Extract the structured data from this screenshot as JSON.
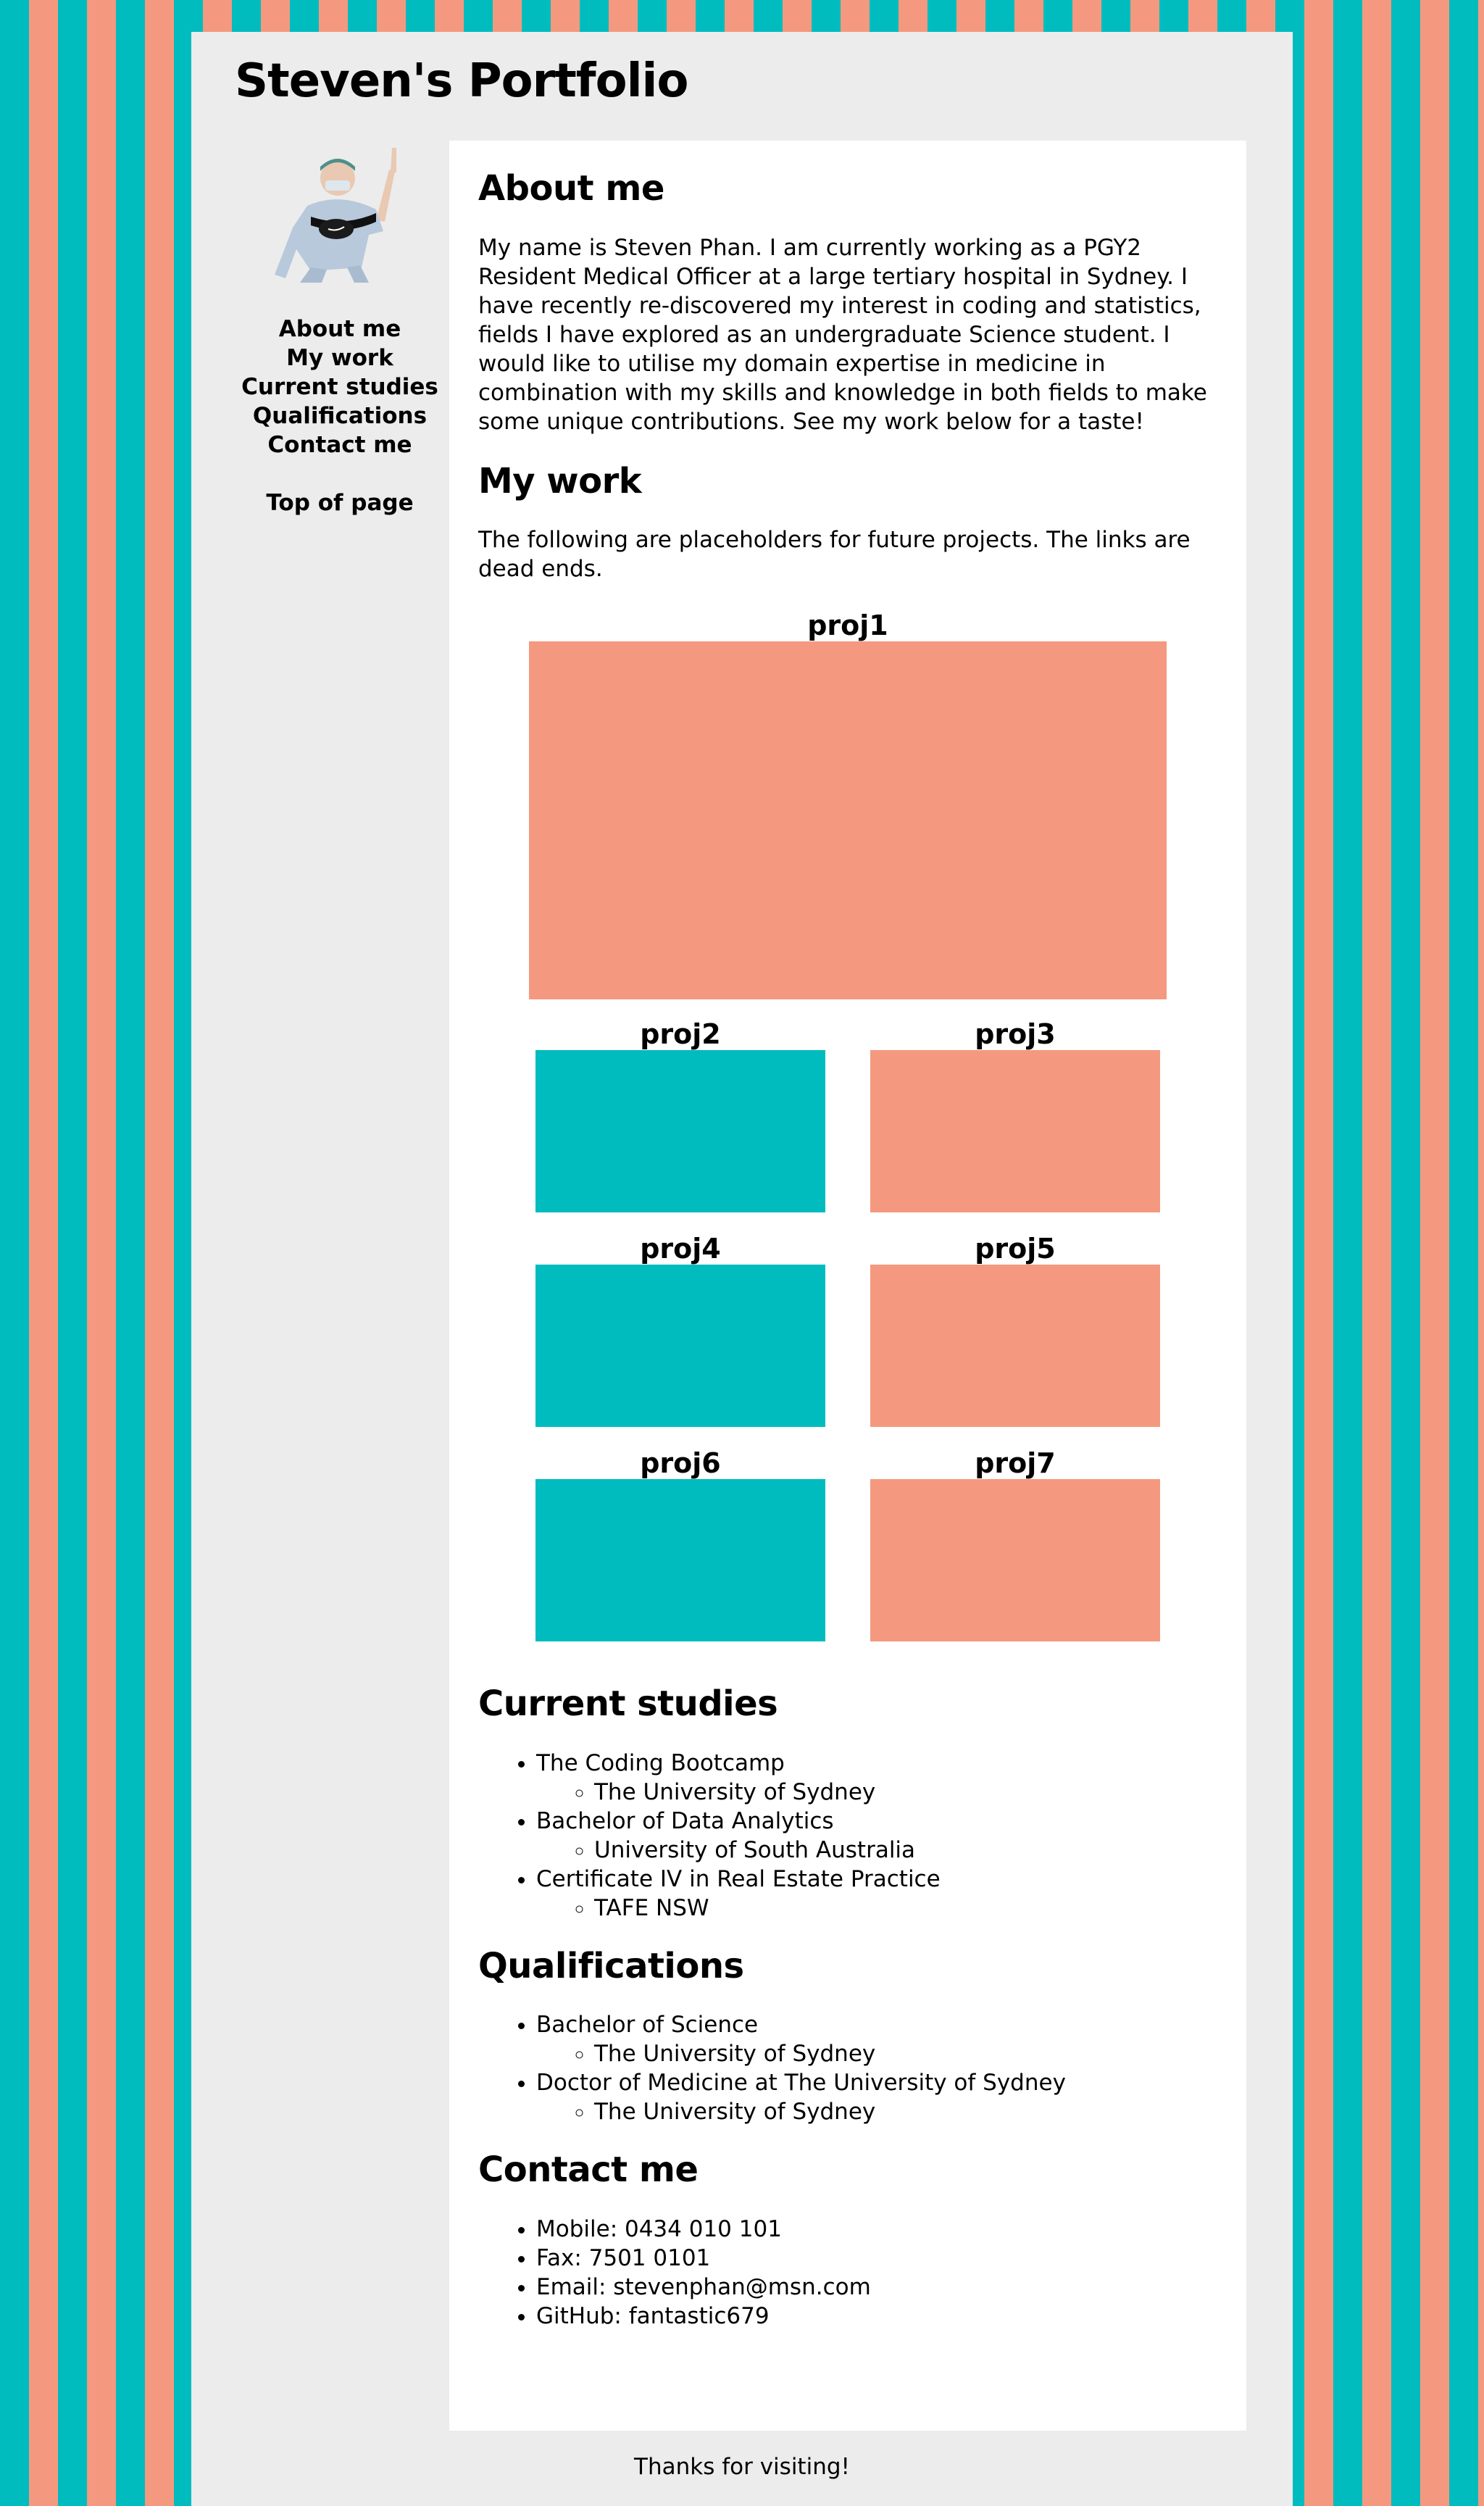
{
  "site_title": "Steven's Portfolio",
  "nav": {
    "items": [
      "About me",
      "My work",
      "Current studies",
      "Qualifications",
      "Contact me"
    ],
    "top_link": "Top of page"
  },
  "about": {
    "heading": "About me",
    "text": "My name is Steven Phan. I am currently working as a PGY2 Resident Medical Officer at a large tertiary hospital in Sydney. I have recently re-discovered my interest in coding and statistics, fields I have explored as an undergraduate Science student. I would like to utilise my domain expertise in medicine in combination with my skills and knowledge in both fields to make some unique contributions. See my work below for a taste!"
  },
  "work": {
    "heading": "My work",
    "intro": "The following are placeholders for future projects. The links are dead ends.",
    "projects": [
      "proj1",
      "proj2",
      "proj3",
      "proj4",
      "proj5",
      "proj6",
      "proj7"
    ]
  },
  "studies": {
    "heading": "Current studies",
    "items": [
      {
        "course": "The Coding Bootcamp",
        "institution": "The University of Sydney"
      },
      {
        "course": "Bachelor of Data Analytics",
        "institution": "University of South Australia"
      },
      {
        "course": "Certificate IV in Real Estate Practice",
        "institution": "TAFE NSW"
      }
    ]
  },
  "qualifications": {
    "heading": "Qualifications",
    "items": [
      {
        "degree": "Bachelor of Science",
        "institution": "The University of Sydney"
      },
      {
        "degree": "Doctor of Medicine at The University of Sydney",
        "institution": "The University of Sydney"
      }
    ]
  },
  "contact": {
    "heading": "Contact me",
    "items": [
      "Mobile: 0434 010 101",
      "Fax: 7501 0101",
      "Email: stevenphan@msn.com",
      "GitHub: fantastic679"
    ]
  },
  "footer": "Thanks for visiting!",
  "colors": {
    "teal": "#00bcbf",
    "salmon": "#f4997f",
    "panel": "#ececec",
    "content": "#ffffff"
  }
}
